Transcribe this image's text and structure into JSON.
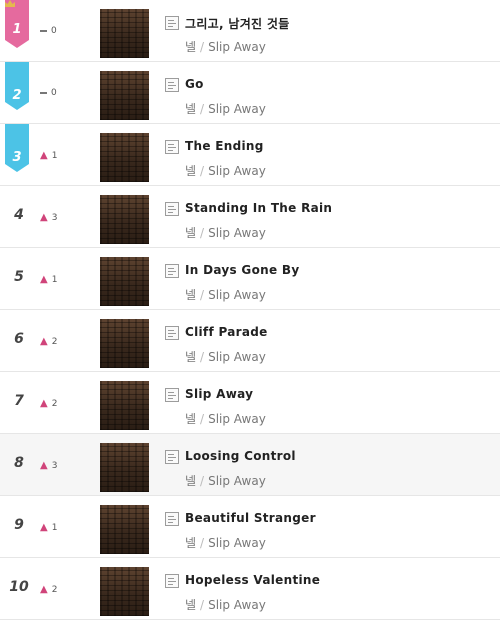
{
  "colors": {
    "gold": "#e4b84d",
    "pink_badge": "#e56a9e",
    "blue_badge": "#4cc3e6",
    "up_arrow": "#d0447a"
  },
  "icons": {
    "crown": "crown-icon",
    "lyrics": "lyrics-icon",
    "steady": "no-change-icon",
    "up": "rank-up-icon"
  },
  "rows": [
    {
      "rank": "1",
      "change": "0",
      "direction": "same",
      "title": "그리고, 남겨진 것들",
      "artist": "넬",
      "album": "Slip Away"
    },
    {
      "rank": "2",
      "change": "0",
      "direction": "same",
      "title": "Go",
      "artist": "넬",
      "album": "Slip Away"
    },
    {
      "rank": "3",
      "change": "1",
      "direction": "up",
      "title": "The Ending",
      "artist": "넬",
      "album": "Slip Away"
    },
    {
      "rank": "4",
      "change": "3",
      "direction": "up",
      "title": "Standing In The Rain",
      "artist": "넬",
      "album": "Slip Away"
    },
    {
      "rank": "5",
      "change": "1",
      "direction": "up",
      "title": "In Days Gone By",
      "artist": "넬",
      "album": "Slip Away"
    },
    {
      "rank": "6",
      "change": "2",
      "direction": "up",
      "title": "Cliff Parade",
      "artist": "넬",
      "album": "Slip Away"
    },
    {
      "rank": "7",
      "change": "2",
      "direction": "up",
      "title": "Slip Away",
      "artist": "넬",
      "album": "Slip Away"
    },
    {
      "rank": "8",
      "change": "3",
      "direction": "up",
      "title": "Loosing Control",
      "artist": "넬",
      "album": "Slip Away"
    },
    {
      "rank": "9",
      "change": "1",
      "direction": "up",
      "title": "Beautiful Stranger",
      "artist": "넬",
      "album": "Slip Away"
    },
    {
      "rank": "10",
      "change": "2",
      "direction": "up",
      "title": "Hopeless Valentine",
      "artist": "넬",
      "album": "Slip Away"
    }
  ]
}
